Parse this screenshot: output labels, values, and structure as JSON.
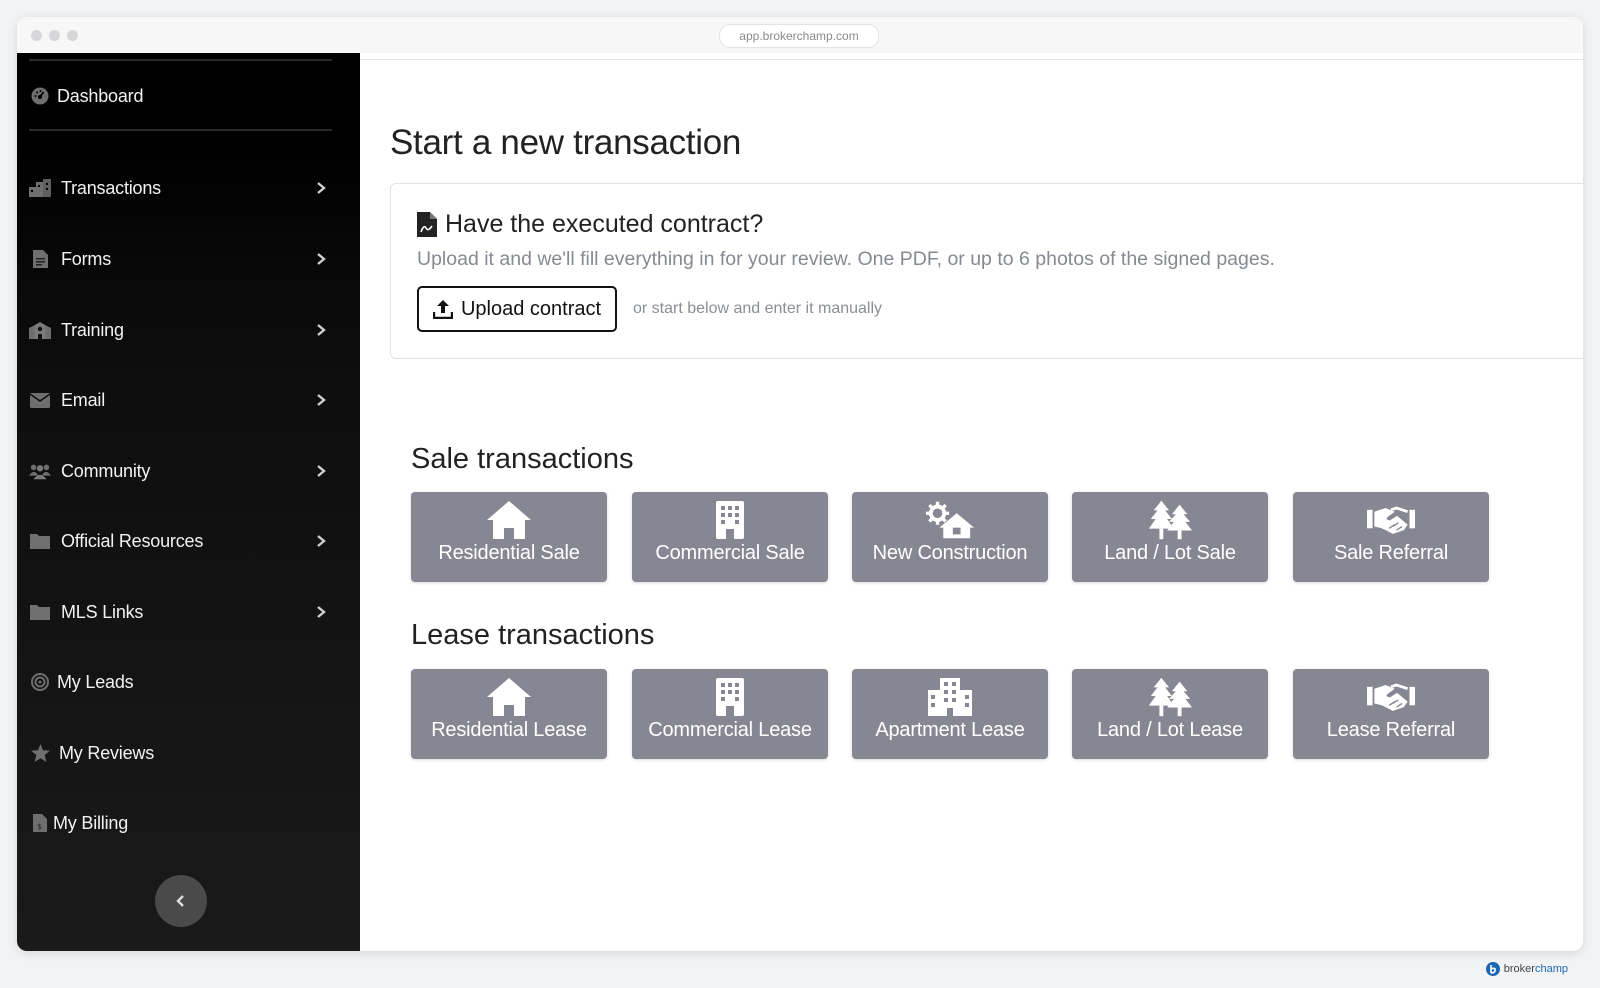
{
  "browser": {
    "url": "app.brokerchamp.com"
  },
  "sidebar": {
    "items": [
      {
        "label": "Dashboard",
        "icon": "dashboard-gauge-icon",
        "chevron": false
      },
      {
        "label": "Transactions",
        "icon": "city-buildings-icon",
        "chevron": true
      },
      {
        "label": "Forms",
        "icon": "document-icon",
        "chevron": true
      },
      {
        "label": "Training",
        "icon": "school-icon",
        "chevron": true
      },
      {
        "label": "Email",
        "icon": "envelope-icon",
        "chevron": true
      },
      {
        "label": "Community",
        "icon": "users-icon",
        "chevron": true
      },
      {
        "label": "Official Resources",
        "icon": "folder-icon",
        "chevron": true
      },
      {
        "label": "MLS Links",
        "icon": "folder-icon",
        "chevron": true
      },
      {
        "label": "My Leads",
        "icon": "target-icon",
        "chevron": false
      },
      {
        "label": "My Reviews",
        "icon": "star-icon",
        "chevron": false
      },
      {
        "label": "My Billing",
        "icon": "invoice-icon",
        "chevron": false
      }
    ],
    "collapse_icon": "chevron-left-icon"
  },
  "main": {
    "title": "Start a new transaction",
    "upload": {
      "title": "Have the executed contract?",
      "description": "Upload it and we'll fill everything in for your review. One PDF, or up to 6 photos of the signed pages.",
      "button_label": "Upload contract",
      "hint": "or start below and enter it manually"
    },
    "sale_section": {
      "title": "Sale transactions",
      "tiles": [
        {
          "label": "Residential Sale",
          "icon": "house-icon"
        },
        {
          "label": "Commercial Sale",
          "icon": "office-building-icon"
        },
        {
          "label": "New Construction",
          "icon": "gear-house-icon"
        },
        {
          "label": "Land / Lot Sale",
          "icon": "trees-icon"
        },
        {
          "label": "Sale Referral",
          "icon": "handshake-icon"
        }
      ]
    },
    "lease_section": {
      "title": "Lease transactions",
      "tiles": [
        {
          "label": "Residential Lease",
          "icon": "house-icon"
        },
        {
          "label": "Commercial Lease",
          "icon": "office-building-icon"
        },
        {
          "label": "Apartment Lease",
          "icon": "apartment-building-icon"
        },
        {
          "label": "Land / Lot Lease",
          "icon": "trees-icon"
        },
        {
          "label": "Lease Referral",
          "icon": "handshake-icon"
        }
      ]
    }
  },
  "brand": {
    "name_part1": "broker",
    "name_part2": "champ"
  },
  "colors": {
    "sidebar_bg": "#000000",
    "tile_bg": "#878793",
    "brand_blue": "#1b67b3"
  }
}
